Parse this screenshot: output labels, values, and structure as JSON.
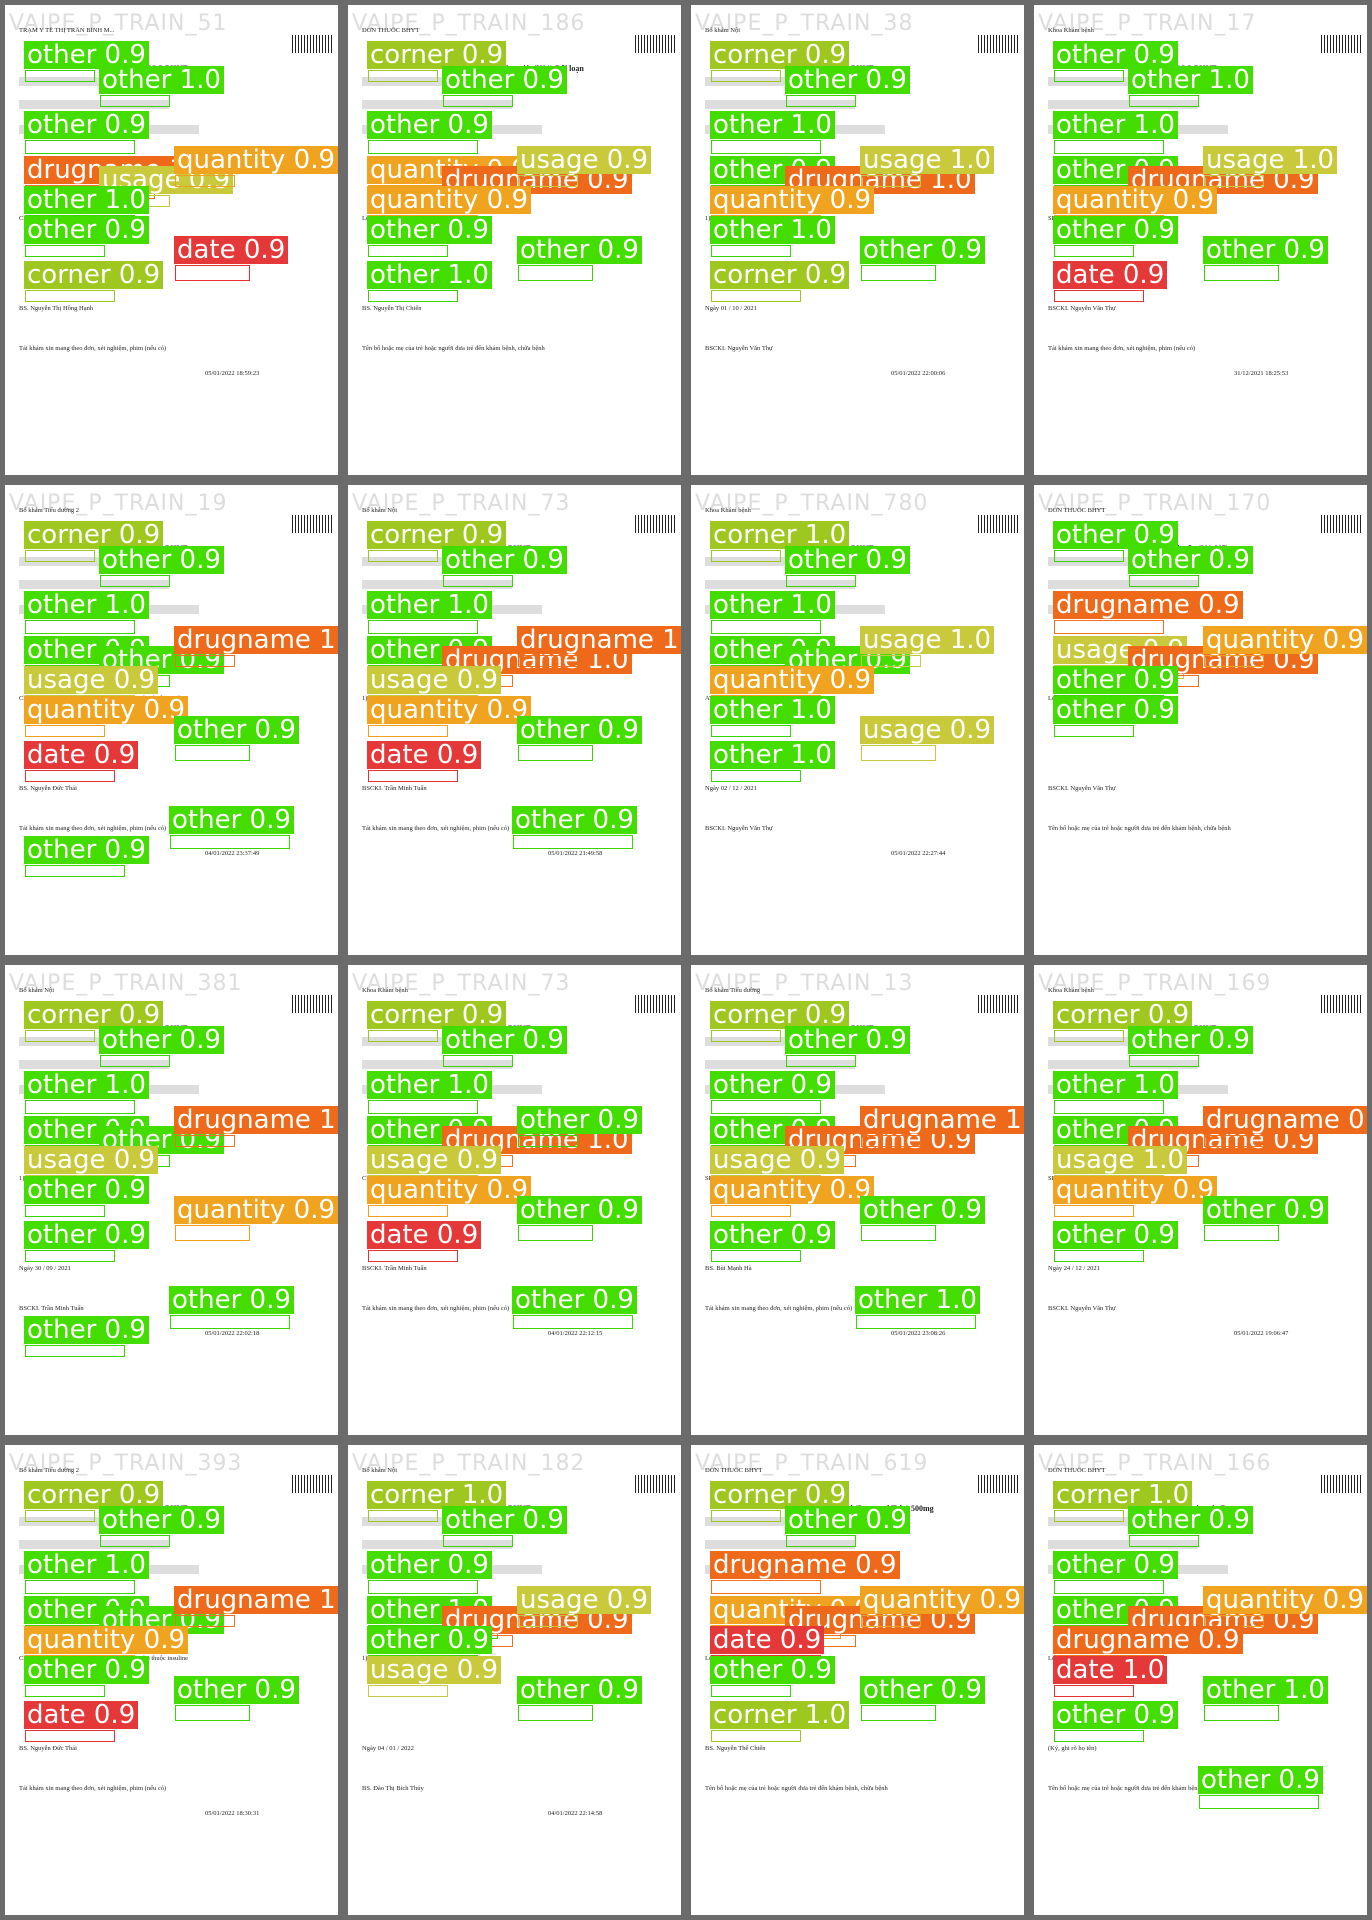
{
  "tiles": [
    {
      "wm": "VAIPE_P_TRAIN_51",
      "lines": [
        "TRẠM Y TẾ THỊ TRẤN BÌNH M...",
        "TOA THUỐC BHYT",
        "Chẩn đoán: I10 - Bệnh lý tăng huyết áp",
        "BS. Nguyễn Thị Hồng Hạnh",
        "Tái khám xin mang theo đơn, xét nghiệm, phim (nếu có)",
        "05/01/2022 18:59:23"
      ]
    },
    {
      "wm": "VAIPE_P_TRAIN_186",
      "lines": [
        "ĐƠN THUỐC BHYT",
        "(H60) Viêm tai ngoài; (H81) Rối loạn",
        "Lời dặn: Uống thuốc theo toa + tái khám sau 1",
        "BS. Nguyễn Thị Chiến",
        "Tên bố hoặc mẹ của trẻ hoặc người đưa trẻ đến khám bệnh, chữa bệnh",
        ""
      ]
    },
    {
      "wm": "VAIPE_P_TRAIN_38",
      "lines": [
        "Bố khám Nội",
        "TOA THUỐC BHYT",
        "1) SAVI PROLOL 5 5mg   SL: 30 viên",
        "Ngày 01 / 10 / 2021",
        "BSCKI. Nguyễn Văn Thự",
        "05/01/2022 22:00:06"
      ]
    },
    {
      "wm": "VAIPE_P_TRAIN_17",
      "lines": [
        "Khoa Khám bệnh",
        "TOA THUỐC BHYT",
        "SL: 20 Viên",
        "BSCKI. Nguyễn Văn Thự",
        "Tái khám xin mang theo đơn, xét nghiệm, phim (nếu có)",
        "31/12/2021 18:25:53"
      ]
    },
    {
      "wm": "VAIPE_P_TRAIN_19",
      "lines": [
        "Bố khám Tiểu đường 2",
        "TOA THUỐC BHYT",
        "Chẩn đoán: E11 - Bệnh đái tháo đường không phụ thuộc insuline",
        "BS. Nguyễn Đức Thái",
        "Tái khám xin mang theo đơn, xét nghiệm, phim (nếu có)",
        "04/01/2022 23:37:49"
      ]
    },
    {
      "wm": "VAIPE_P_TRAIN_73",
      "lines": [
        "Bố khám Nội",
        "TOA THUỐC BHYT",
        "1) KAVASDIN 5 5 mg",
        "BSCKI. Trần Minh Tuấn",
        "Tái khám xin mang theo đơn, xét nghiệm, phim (nếu có)",
        "05/01/2022 21:49:58"
      ]
    },
    {
      "wm": "VAIPE_P_TRAIN_780",
      "lines": [
        "Khoa Khám bệnh",
        "TOA THUỐC BHYT",
        "ATORIS 20MG 20mg   SL: 15 Viên",
        "Ngày 02 / 12 / 2021",
        "BSCKI. Nguyễn Văn Thự",
        "05/01/2022 22:27:44"
      ]
    },
    {
      "wm": "VAIPE_P_TRAIN_170",
      "lines": [
        "ĐƠN THUỐC BHYT",
        "bệnh mạch não (I60-I67)",
        "Lời dặn: Uống thuốc theo toa + tái khám sau 1",
        "BSCKI. Nguyễn Văn Thự",
        "Tên bố hoặc mẹ của trẻ hoặc người đưa trẻ đến khám bệnh, chữa bệnh",
        ""
      ]
    },
    {
      "wm": "VAIPE_P_TRAIN_381",
      "lines": [
        "Bố khám Nội",
        "TOA THUỐC BHYT",
        "1) SAVI PROLOL 5 5mg",
        "Ngày 30 / 09 / 2021",
        "BSCKI. Trần Minh Tuấn",
        "05/01/2022 22:02:18"
      ]
    },
    {
      "wm": "VAIPE_P_TRAIN_73",
      "lines": [
        "Khoa Khám bệnh",
        "TOA THUỐC BHYT",
        "Chẩn đoán: I10 - Bệnh lý tăng huyết áp",
        "BSCKI. Trần Minh Tuấn",
        "Tái khám xin mang theo đơn, xét nghiệm, phim (nếu có)",
        "04/01/2022 22:12:15"
      ]
    },
    {
      "wm": "VAIPE_P_TRAIN_13",
      "lines": [
        "Bố khám Tiểu đường",
        "TOA THUỐC BHYT",
        "SL: 60 Viên",
        "BS. Bùi Mạnh Hà",
        "Tái khám xin mang theo đơn, xét nghiệm, phim (nếu có)",
        "05/01/2022 23:08:26"
      ]
    },
    {
      "wm": "VAIPE_P_TRAIN_169",
      "lines": [
        "Khoa Khám bệnh",
        "TOA THUỐC BHYT",
        "SL: 20 Viên",
        "Ngày 24 / 12 / 2021",
        "BSCKI. Nguyễn Văn Thự",
        "05/01/2022 19:06:47"
      ]
    },
    {
      "wm": "VAIPE_P_TRAIN_393",
      "lines": [
        "Bố khám Tiểu đường 2",
        "TOA THUỐC BHYT",
        "Chẩn đoán: E11 - Bệnh đái tháo đường không phụ thuộc insuline",
        "BS. Nguyễn Đức Thái",
        "Tái khám xin mang theo đơn, xét nghiệm, phim (nếu có)",
        "05/01/2022 18:30:31"
      ]
    },
    {
      "wm": "VAIPE_P_TRAIN_182",
      "lines": [
        "Bố khám Nội",
        "TOA THUỐC BHYT",
        "1) SAVIPROLOL 2.5 2.5mg   40 Viên",
        "Ngày 04 / 01 / 2022",
        "BS. Đào Thị Bích Thủy",
        "04/01/2022 22:14:58"
      ]
    },
    {
      "wm": "VAIPE_P_TRAIN_619",
      "lines": [
        "ĐƠN THUỐC BHYT",
        "1) Paracetamol (Partamol Tab.) 500mg",
        "Lời dặn: Uống thuốc theo toa + tái khám sau",
        "BS. Nguyễn Thế Chiến",
        "Tên bố hoặc mẹ của trẻ hoặc người đưa trẻ đến khám bệnh, chữa bệnh",
        ""
      ]
    },
    {
      "wm": "VAIPE_P_TRAIN_166",
      "lines": [
        "ĐƠN THUỐC BHYT",
        "(E53.9) Thiếu vitamin B,",
        "Lời dặn:",
        "(Ký, ghi rõ họ tên)",
        "Tên bố hoặc mẹ của trẻ hoặc người đưa trẻ đến khám bệnh, chữa bệnh",
        ""
      ]
    }
  ],
  "detections": [
    [
      [
        "other",
        "0.9"
      ],
      [
        "other",
        "1.0"
      ],
      [
        "other",
        "0.9"
      ],
      [
        "drugname",
        "1.0"
      ],
      [
        "usage",
        "0.9"
      ],
      [
        "quantity",
        "0.9"
      ],
      [
        "other",
        "1.0"
      ],
      [
        "other",
        "0.9"
      ],
      [
        "date",
        "0.9"
      ],
      [
        "corner",
        "0.9"
      ]
    ],
    [
      [
        "corner",
        "0.9"
      ],
      [
        "other",
        "0.9"
      ],
      [
        "other",
        "0.9"
      ],
      [
        "quantity",
        "0.9"
      ],
      [
        "drugname",
        "0.9"
      ],
      [
        "usage",
        "0.9"
      ],
      [
        "quantity",
        "0.9"
      ],
      [
        "other",
        "0.9"
      ],
      [
        "other",
        "0.9"
      ],
      [
        "other",
        "1.0"
      ]
    ],
    [
      [
        "corner",
        "0.9"
      ],
      [
        "other",
        "0.9"
      ],
      [
        "other",
        "1.0"
      ],
      [
        "other",
        "0.9"
      ],
      [
        "drugname",
        "1.0"
      ],
      [
        "usage",
        "1.0"
      ],
      [
        "quantity",
        "0.9"
      ],
      [
        "other",
        "1.0"
      ],
      [
        "other",
        "0.9"
      ],
      [
        "corner",
        "0.9"
      ]
    ],
    [
      [
        "other",
        "0.9"
      ],
      [
        "other",
        "1.0"
      ],
      [
        "other",
        "1.0"
      ],
      [
        "other",
        "0.9"
      ],
      [
        "drugname",
        "0.9"
      ],
      [
        "usage",
        "1.0"
      ],
      [
        "quantity",
        "0.9"
      ],
      [
        "other",
        "0.9"
      ],
      [
        "other",
        "0.9"
      ],
      [
        "date",
        "0.9"
      ]
    ],
    [
      [
        "corner",
        "0.9"
      ],
      [
        "other",
        "0.9"
      ],
      [
        "other",
        "1.0"
      ],
      [
        "other",
        "0.9"
      ],
      [
        "other",
        "0.9"
      ],
      [
        "drugname",
        "1.0"
      ],
      [
        "usage",
        "0.9"
      ],
      [
        "quantity",
        "0.9"
      ],
      [
        "other",
        "0.9"
      ],
      [
        "date",
        "0.9"
      ],
      [
        "other",
        "0.9"
      ],
      [
        "other",
        "0.9"
      ]
    ],
    [
      [
        "corner",
        "0.9"
      ],
      [
        "other",
        "0.9"
      ],
      [
        "other",
        "1.0"
      ],
      [
        "other",
        "0.9"
      ],
      [
        "drugname",
        "1.0"
      ],
      [
        "drugname",
        "1.0"
      ],
      [
        "usage",
        "0.9"
      ],
      [
        "quantity",
        "0.9"
      ],
      [
        "other",
        "0.9"
      ],
      [
        "date",
        "0.9"
      ],
      [
        "other",
        "0.9"
      ]
    ],
    [
      [
        "corner",
        "1.0"
      ],
      [
        "other",
        "0.9"
      ],
      [
        "other",
        "1.0"
      ],
      [
        "other",
        "0.9"
      ],
      [
        "other",
        "0.9"
      ],
      [
        "usage",
        "1.0"
      ],
      [
        "quantity",
        "0.9"
      ],
      [
        "other",
        "1.0"
      ],
      [
        "usage",
        "0.9"
      ],
      [
        "other",
        "1.0"
      ]
    ],
    [
      [
        "other",
        "0.9"
      ],
      [
        "other",
        "0.9"
      ],
      [
        "drugname",
        "0.9"
      ],
      [
        "usage",
        "0.9"
      ],
      [
        "drugname",
        "0.9"
      ],
      [
        "quantity",
        "0.9"
      ],
      [
        "other",
        "0.9"
      ],
      [
        "other",
        "0.9"
      ]
    ],
    [
      [
        "corner",
        "0.9"
      ],
      [
        "other",
        "0.9"
      ],
      [
        "other",
        "1.0"
      ],
      [
        "other",
        "0.9"
      ],
      [
        "other",
        "0.9"
      ],
      [
        "drugname",
        "1.0"
      ],
      [
        "usage",
        "0.9"
      ],
      [
        "other",
        "0.9"
      ],
      [
        "quantity",
        "0.9"
      ],
      [
        "other",
        "0.9"
      ],
      [
        "other",
        "0.9"
      ],
      [
        "other",
        "0.9"
      ]
    ],
    [
      [
        "corner",
        "0.9"
      ],
      [
        "other",
        "0.9"
      ],
      [
        "other",
        "1.0"
      ],
      [
        "other",
        "0.9"
      ],
      [
        "drugname",
        "1.0"
      ],
      [
        "other",
        "0.9"
      ],
      [
        "usage",
        "0.9"
      ],
      [
        "quantity",
        "0.9"
      ],
      [
        "other",
        "0.9"
      ],
      [
        "date",
        "0.9"
      ],
      [
        "other",
        "0.9"
      ]
    ],
    [
      [
        "corner",
        "0.9"
      ],
      [
        "other",
        "0.9"
      ],
      [
        "other",
        "0.9"
      ],
      [
        "other",
        "0.9"
      ],
      [
        "drugname",
        "0.9"
      ],
      [
        "drugname",
        "1.0"
      ],
      [
        "usage",
        "0.9"
      ],
      [
        "quantity",
        "0.9"
      ],
      [
        "other",
        "0.9"
      ],
      [
        "other",
        "0.9"
      ],
      [
        "other",
        "1.0"
      ]
    ],
    [
      [
        "corner",
        "0.9"
      ],
      [
        "other",
        "0.9"
      ],
      [
        "other",
        "1.0"
      ],
      [
        "other",
        "0.9"
      ],
      [
        "drugname",
        "0.9"
      ],
      [
        "drugname",
        "0.9"
      ],
      [
        "usage",
        "1.0"
      ],
      [
        "quantity",
        "0.9"
      ],
      [
        "other",
        "0.9"
      ],
      [
        "other",
        "0.9"
      ]
    ],
    [
      [
        "corner",
        "0.9"
      ],
      [
        "other",
        "0.9"
      ],
      [
        "other",
        "1.0"
      ],
      [
        "other",
        "0.9"
      ],
      [
        "other",
        "0.9"
      ],
      [
        "drugname",
        "1.0"
      ],
      [
        "quantity",
        "0.9"
      ],
      [
        "other",
        "0.9"
      ],
      [
        "other",
        "0.9"
      ],
      [
        "date",
        "0.9"
      ]
    ],
    [
      [
        "corner",
        "1.0"
      ],
      [
        "other",
        "0.9"
      ],
      [
        "other",
        "0.9"
      ],
      [
        "other",
        "1.0"
      ],
      [
        "drugname",
        "0.9"
      ],
      [
        "usage",
        "0.9"
      ],
      [
        "other",
        "0.9"
      ],
      [
        "usage",
        "0.9"
      ],
      [
        "other",
        "0.9"
      ]
    ],
    [
      [
        "corner",
        "0.9"
      ],
      [
        "other",
        "0.9"
      ],
      [
        "drugname",
        "0.9"
      ],
      [
        "quantity",
        "0.9"
      ],
      [
        "drugname",
        "0.9"
      ],
      [
        "quantity",
        "0.9"
      ],
      [
        "date",
        "0.9"
      ],
      [
        "other",
        "0.9"
      ],
      [
        "other",
        "0.9"
      ],
      [
        "corner",
        "1.0"
      ]
    ],
    [
      [
        "corner",
        "1.0"
      ],
      [
        "other",
        "0.9"
      ],
      [
        "other",
        "0.9"
      ],
      [
        "other",
        "0.9"
      ],
      [
        "drugname",
        "0.9"
      ],
      [
        "quantity",
        "0.9"
      ],
      [
        "drugname",
        "0.9"
      ],
      [
        "date",
        "1.0"
      ],
      [
        "other",
        "1.0"
      ],
      [
        "other",
        "0.9"
      ],
      [
        "other",
        "0.9"
      ]
    ]
  ]
}
